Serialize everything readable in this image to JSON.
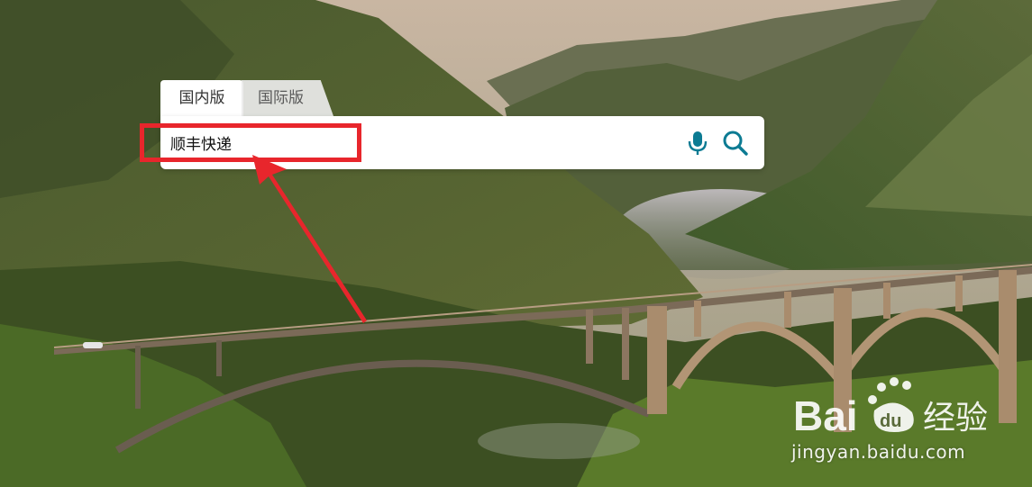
{
  "search_tabs": {
    "domestic_label": "国内版",
    "international_label": "国际版"
  },
  "search": {
    "query": "顺丰快递",
    "mic_icon": "microphone-icon",
    "search_icon": "magnifier-icon",
    "accent_color": "#0c7b93"
  },
  "annotation": {
    "color": "#e8262c"
  },
  "watermark": {
    "brand": "Baidu经验",
    "url": "jingyan.baidu.com"
  }
}
